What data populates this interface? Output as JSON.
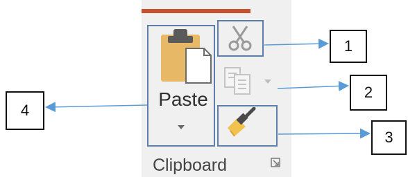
{
  "colors": {
    "accent_bar": "#c5502d",
    "ribbon_bg": "#f0f0f0",
    "highlight_border": "#5b7fa8",
    "arrow": "#5b9bd5"
  },
  "clipboard": {
    "paste_label": "Paste",
    "group_label": "Clipboard",
    "buttons": {
      "paste_icon": "clipboard-paste-icon",
      "cut_icon": "scissors-icon",
      "copy_icon": "copy-icon",
      "format_painter_icon": "paintbrush-icon",
      "launcher_icon": "dialog-launcher-icon"
    }
  },
  "callouts": {
    "cut": "1",
    "copy": "2",
    "format_painter": "3",
    "paste": "4"
  }
}
